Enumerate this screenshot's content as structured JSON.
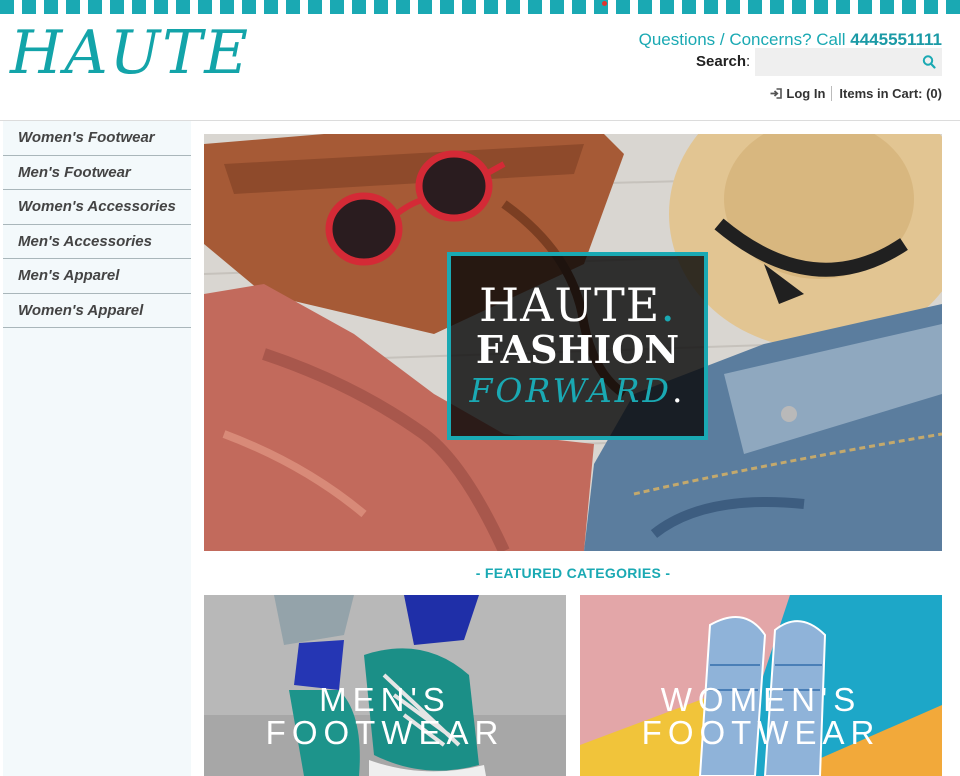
{
  "brand": {
    "logo": "HAUTE",
    "accent": "#1aa9b3"
  },
  "header": {
    "contact_prefix": "Questions / Concerns? Call ",
    "phone": "4445551111",
    "search_label": "Search",
    "search_colon": ":",
    "search_placeholder": "",
    "login_label": "Log In",
    "cart_label": "Items in Cart: (0)"
  },
  "sidebar": {
    "items": [
      {
        "label": "Women's Footwear"
      },
      {
        "label": "Men's Footwear"
      },
      {
        "label": "Women's Accessories"
      },
      {
        "label": "Men's Accessories"
      },
      {
        "label": "Men's Apparel"
      },
      {
        "label": "Women's Apparel"
      }
    ]
  },
  "hero": {
    "line1": "HAUTE",
    "line2": "FASHION",
    "line3": "FORWARD",
    "dot": "."
  },
  "featured": {
    "title": "-  FEATURED CATEGORIES  -",
    "cards": [
      {
        "line1": "MEN'S",
        "line2": "FOOTWEAR"
      },
      {
        "line1": "WOMEN'S",
        "line2": "FOOTWEAR"
      }
    ]
  }
}
